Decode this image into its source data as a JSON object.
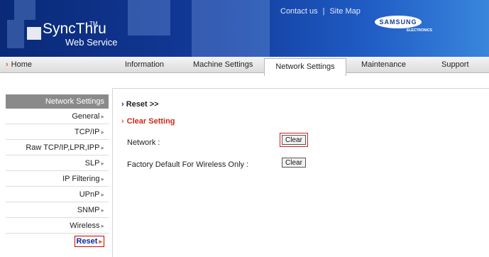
{
  "header": {
    "logo_name": "SyncThru",
    "logo_tm": "TM",
    "logo_sub": "Web Service",
    "contact": "Contact us",
    "separator": "|",
    "sitemap": "Site Map",
    "brand": "SAMSUNG",
    "brand_sub": "ELECTRONICS"
  },
  "nav": {
    "home": "Home",
    "items": [
      "Information",
      "Machine Settings",
      "Network Settings",
      "Maintenance",
      "Support"
    ],
    "active": "Network Settings"
  },
  "sidebar": {
    "title": "Network Settings",
    "items": [
      {
        "label": "General"
      },
      {
        "label": "TCP/IP"
      },
      {
        "label": "Raw TCP/IP,LPR,IPP"
      },
      {
        "label": "SLP"
      },
      {
        "label": "IP Filtering"
      },
      {
        "label": "UPnP"
      },
      {
        "label": "SNMP"
      },
      {
        "label": "Wireless"
      },
      {
        "label": "Reset"
      }
    ],
    "selected": "Reset"
  },
  "main": {
    "breadcrumb": "Reset >>",
    "section_title": "Clear Setting",
    "rows": [
      {
        "label": "Network :",
        "button": "Clear"
      },
      {
        "label": "Factory Default For Wireless Only :",
        "button": "Clear"
      }
    ]
  },
  "colors": {
    "banner": "#123a9a",
    "accent_orange": "#e0621a",
    "section_red": "#cc2a1a",
    "highlight_border": "#d02020"
  }
}
